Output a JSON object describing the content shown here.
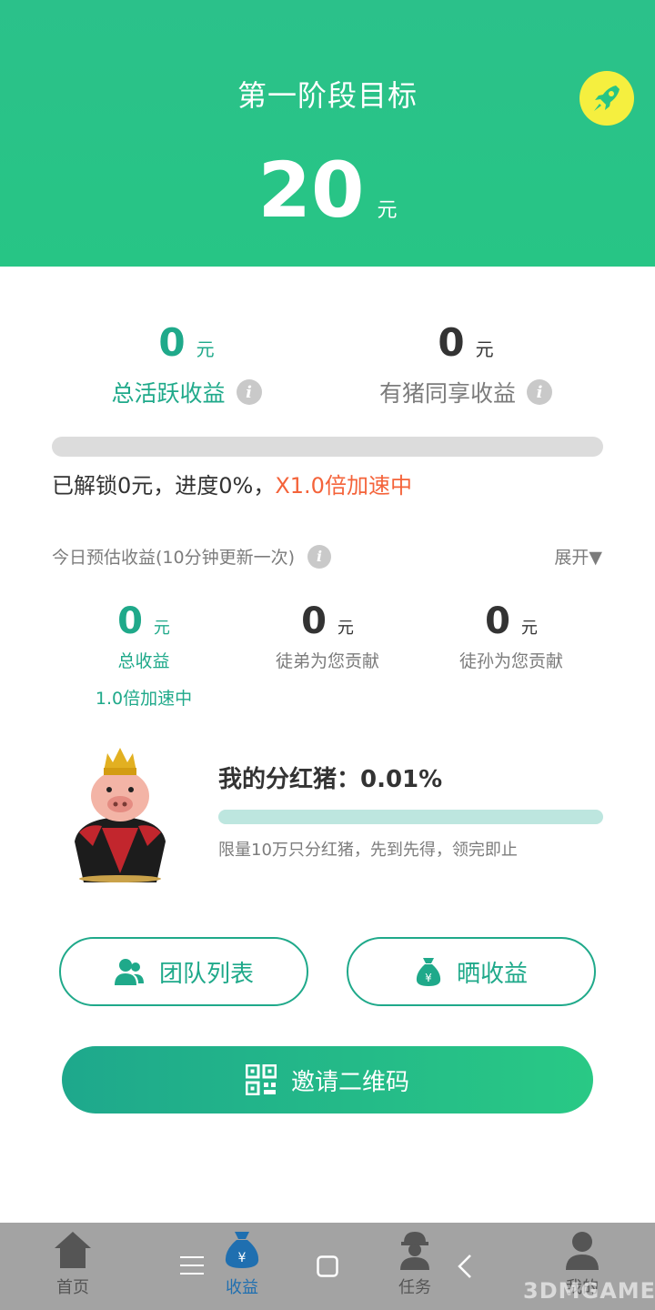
{
  "header": {
    "title": "第一阶段目标",
    "target_amount": "20",
    "target_unit": "元"
  },
  "earnings": {
    "total_active": {
      "amount": "0",
      "unit": "元",
      "label": "总活跃收益"
    },
    "shared": {
      "amount": "0",
      "unit": "元",
      "label": "有猪同享收益"
    }
  },
  "progress": {
    "value_fraction": 0.0,
    "text_prefix": "已解锁0元，进度0%，",
    "speed_text": "X1.0倍加速中"
  },
  "today": {
    "title": "今日预估收益(10分钟更新一次)",
    "expand_label": "展开▼",
    "columns": [
      {
        "amount": "0",
        "unit": "元",
        "label": "总收益",
        "sub": "1.0倍加速中"
      },
      {
        "amount": "0",
        "unit": "元",
        "label": "徒弟为您贡献"
      },
      {
        "amount": "0",
        "unit": "元",
        "label": "徒孙为您贡献"
      }
    ]
  },
  "dividend_pig": {
    "title": "我的分红猪：0.01%",
    "percent_fraction": 0.0001,
    "note": "限量10万只分红猪，先到先得，领完即止"
  },
  "buttons": {
    "team_list": "团队列表",
    "share_earnings": "晒收益",
    "invite_qr": "邀请二维码"
  },
  "nav": {
    "items": [
      {
        "label": "首页",
        "icon": "home-icon"
      },
      {
        "label": "收益",
        "icon": "money-bag-icon"
      },
      {
        "label": "任务",
        "icon": "worker-icon"
      },
      {
        "label": "我的",
        "icon": "person-icon"
      }
    ]
  },
  "watermark": "3DMGAME",
  "colors": {
    "brand_green": "#27c585",
    "text_green": "#1fa98a",
    "highlight_orange": "#f4633a",
    "rocket_yellow": "#f5ef3f"
  }
}
